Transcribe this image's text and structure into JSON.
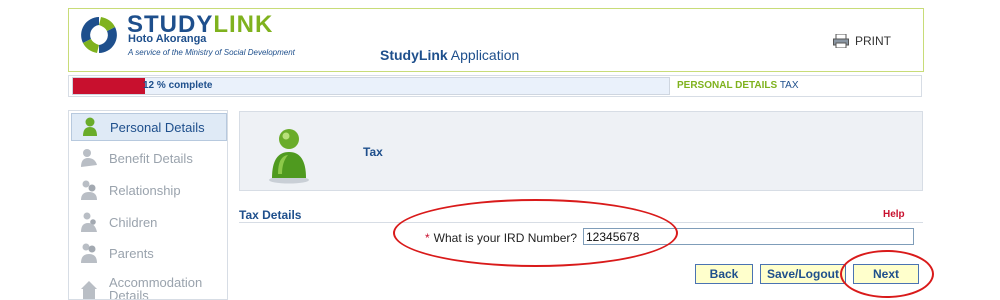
{
  "header": {
    "logo_studylink": "STUDY",
    "logo_link": "LINK",
    "logo_subtitle": "Hoto Akoranga",
    "logo_tagline": "A service of the Ministry of Social Development",
    "app_title_brand": "StudyLink",
    "app_title_text": "Application",
    "print_label": "PRINT"
  },
  "progress": {
    "percent": 12,
    "label": "12 % complete",
    "step_current": "PERSONAL DETAILS",
    "step_sub": "TAX"
  },
  "sidebar": {
    "items": [
      {
        "label": "Personal Details",
        "icon": "person-green-icon",
        "active": true
      },
      {
        "label": "Benefit Details",
        "icon": "benefit-icon",
        "active": false
      },
      {
        "label": "Relationship",
        "icon": "relationship-icon",
        "active": false
      },
      {
        "label": "Children",
        "icon": "children-icon",
        "active": false
      },
      {
        "label": "Parents",
        "icon": "parents-icon",
        "active": false
      },
      {
        "label": "Accommodation Details",
        "icon": "house-icon",
        "active": false
      }
    ]
  },
  "panel": {
    "title": "Tax"
  },
  "section": {
    "title": "Tax Details",
    "help": "Help"
  },
  "form": {
    "required_marker": "*",
    "ird_label": "What is your IRD Number?",
    "ird_value": "12345678"
  },
  "buttons": {
    "back": "Back",
    "save": "Save/Logout",
    "next": "Next"
  },
  "colors": {
    "brand_blue": "#1e4f8c",
    "brand_green": "#7fb21e",
    "progress_red": "#c8102e",
    "annotation_red": "#d91a1a",
    "button_fill": "#ffffcc"
  }
}
